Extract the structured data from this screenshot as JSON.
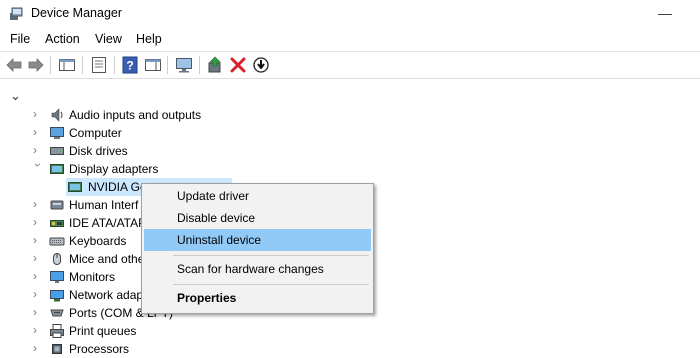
{
  "window": {
    "title": "Device Manager",
    "minimize_icon": "minimize-icon"
  },
  "menu": {
    "items": [
      "File",
      "Action",
      "View",
      "Help"
    ]
  },
  "toolbar": {
    "buttons": [
      "back-arrow-icon",
      "forward-arrow-icon",
      "show-hide-console-tree-icon",
      "properties-icon",
      "help-icon",
      "action-pane-icon",
      "monitor-icon",
      "update-driver-icon",
      "uninstall-icon",
      "disable-icon"
    ]
  },
  "tree": {
    "root_expanded": true,
    "items": [
      {
        "label": "Audio inputs and outputs",
        "expanded": false,
        "icon": "speaker-icon"
      },
      {
        "label": "Computer",
        "expanded": false,
        "icon": "computer-icon"
      },
      {
        "label": "Disk drives",
        "expanded": false,
        "icon": "disk-drive-icon"
      },
      {
        "label": "Display adapters",
        "expanded": true,
        "icon": "display-adapter-icon"
      },
      {
        "label": "NVIDIA Ge",
        "child": true,
        "selected": true,
        "icon": "display-adapter-icon"
      },
      {
        "label": "Human Interf",
        "expanded": false,
        "icon": "hid-icon"
      },
      {
        "label": "IDE ATA/ATAP",
        "expanded": false,
        "icon": "ide-controller-icon"
      },
      {
        "label": "Keyboards",
        "expanded": false,
        "icon": "keyboard-icon"
      },
      {
        "label": "Mice and othe",
        "expanded": false,
        "icon": "mouse-icon"
      },
      {
        "label": "Monitors",
        "expanded": false,
        "icon": "monitor-icon"
      },
      {
        "label": "Network adap",
        "expanded": false,
        "icon": "network-adapter-icon"
      },
      {
        "label": "Ports (COM & LPT)",
        "expanded": false,
        "icon": "port-icon"
      },
      {
        "label": "Print queues",
        "expanded": false,
        "icon": "printer-icon"
      },
      {
        "label": "Processors",
        "expanded": false,
        "icon": "processor-icon"
      }
    ]
  },
  "context_menu": {
    "items": [
      {
        "label": "Update driver"
      },
      {
        "label": "Disable device"
      },
      {
        "label": "Uninstall device",
        "highlighted": true
      },
      {
        "label": "Scan for hardware changes"
      },
      {
        "label": "Properties",
        "bold": true
      }
    ]
  },
  "colors": {
    "selection": "#cce8ff",
    "menu_highlight": "#91c9f7",
    "uninstall_red": "#d9202a",
    "update_green": "#2e9e3e"
  }
}
